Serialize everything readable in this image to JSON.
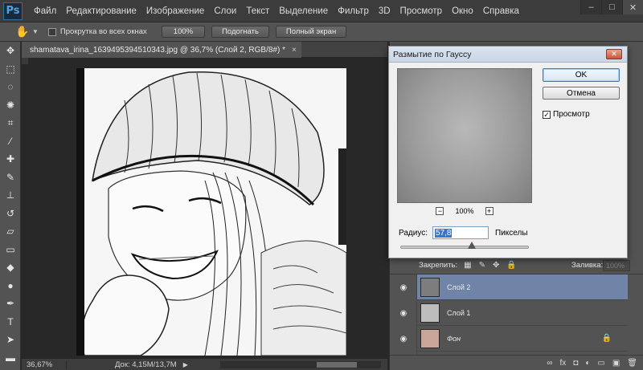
{
  "app": {
    "logo": "Ps"
  },
  "menu": [
    "Файл",
    "Редактирование",
    "Изображение",
    "Слои",
    "Текст",
    "Выделение",
    "Фильтр",
    "3D",
    "Просмотр",
    "Окно",
    "Справка"
  ],
  "window_controls": {
    "minimize": "‒",
    "maximize": "□",
    "close": "✕"
  },
  "options_bar": {
    "scroll_all_label": "Прокрутка во всех окнах",
    "btn_100": "100%",
    "btn_fit": "Подогнать",
    "btn_fullscreen": "Полный экран"
  },
  "document": {
    "tab_title": "shamatava_irina_1639495394510343.jpg @ 36,7% (Слой 2, RGB/8#) *",
    "tab_close": "×"
  },
  "status": {
    "zoom": "36,67%",
    "doc_info": "Док: 4,15M/13,7M",
    "arrow": "▶"
  },
  "dialog": {
    "title": "Размытие по Гауссу",
    "close": "✕",
    "ok": "OK",
    "cancel": "Отмена",
    "preview_label": "Просмотр",
    "preview_checked": true,
    "zoom_minus": "−",
    "zoom_plus": "+",
    "zoom_level": "100%",
    "radius_label": "Радиус:",
    "radius_value": "57,8",
    "radius_unit": "Пикселы"
  },
  "layers": {
    "lock_label": "Закрепить:",
    "fill_label": "Заливка:",
    "fill_value": "100%",
    "items": [
      {
        "name": "Слой 2",
        "active": true,
        "thumb_color": "#7d7d7d",
        "locked": false
      },
      {
        "name": "Слой 1",
        "active": false,
        "thumb_color": "#bdbdbd",
        "locked": false
      },
      {
        "name": "Фон",
        "active": false,
        "thumb_color": "#c9a59a",
        "locked": true
      }
    ]
  },
  "colors": {
    "accent": "#6f84a7",
    "ui_dark": "#282828",
    "ui_panel": "#535353"
  }
}
